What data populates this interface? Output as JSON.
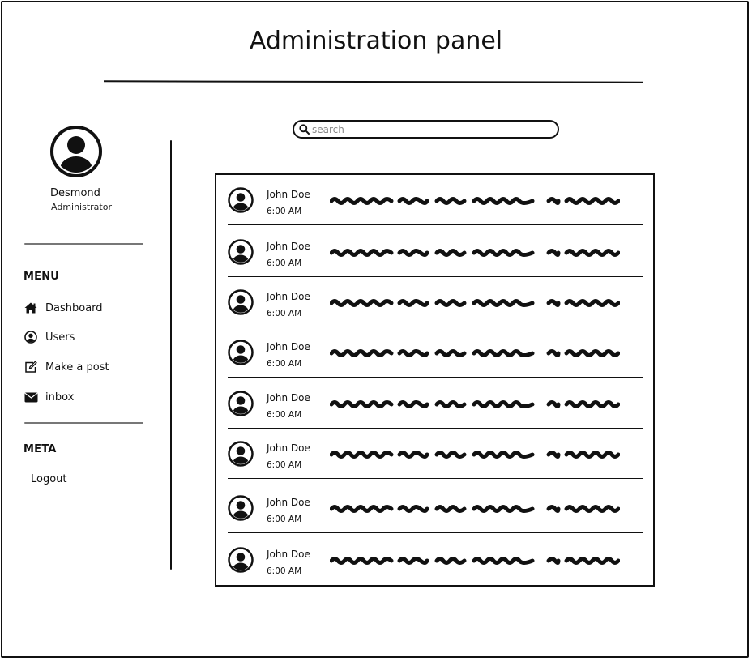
{
  "page": {
    "title": "Administration panel"
  },
  "profile": {
    "name": "Desmond",
    "role": "Administrator",
    "avatar_icon": "user-circle-icon"
  },
  "sidebar": {
    "menu_heading": "MENU",
    "items": [
      {
        "label": "Dashboard",
        "icon": "home-icon"
      },
      {
        "label": "Users",
        "icon": "user-circle-icon"
      },
      {
        "label": "Make a post",
        "icon": "edit-icon"
      },
      {
        "label": "inbox",
        "icon": "envelope-icon"
      }
    ],
    "meta_heading": "META",
    "logout_label": "Logout"
  },
  "search": {
    "placeholder": "search",
    "value": ""
  },
  "messages": [
    {
      "name": "John Doe",
      "time": "6:00 AM"
    },
    {
      "name": "John Doe",
      "time": "6:00 AM"
    },
    {
      "name": "John Doe",
      "time": "6:00 AM"
    },
    {
      "name": "John Doe",
      "time": "6:00 AM"
    },
    {
      "name": "John Doe",
      "time": "6:00 AM"
    },
    {
      "name": "John Doe",
      "time": "6:00 AM"
    },
    {
      "name": "John Doe",
      "time": "6:00 AM"
    },
    {
      "name": "John Doe",
      "time": "6:00 AM"
    }
  ]
}
